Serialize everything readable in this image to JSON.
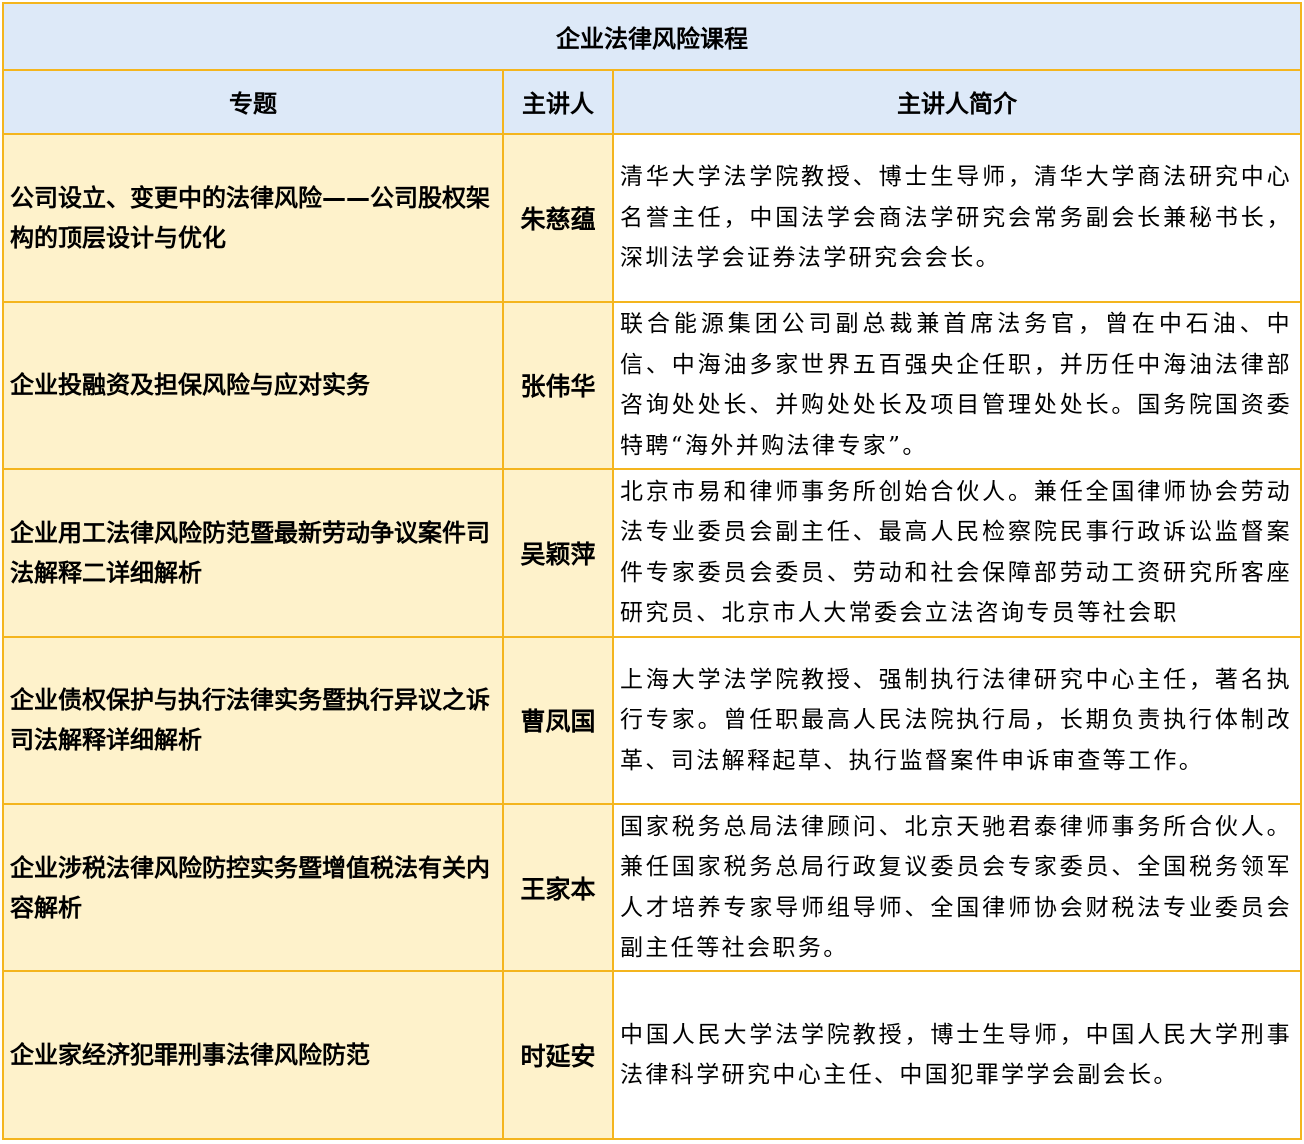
{
  "table": {
    "title": "企业法律风险课程",
    "headers": {
      "topic": "专题",
      "speaker": "主讲人",
      "bio": "主讲人简介"
    },
    "rows": [
      {
        "topic": "公司设立、变更中的法律风险——公司股权架构的顶层设计与优化",
        "speaker": "朱慈蕴",
        "bio": "清华大学法学院教授、博士生导师，清华大学商法研究中心名誉主任，中国法学会商法学研究会常务副会长兼秘书长，深圳法学会证券法学研究会会长。"
      },
      {
        "topic": "企业投融资及担保风险与应对实务",
        "speaker": "张伟华",
        "bio": "联合能源集团公司副总裁兼首席法务官，曾在中石油、中信、中海油多家世界五百强央企任职，并历任中海油法律部咨询处处长、并购处处长及项目管理处处长。国务院国资委特聘“海外并购法律专家”。"
      },
      {
        "topic": "企业用工法律风险防范暨最新劳动争议案件司法解释二详细解析",
        "speaker": "吴颖萍",
        "bio": "北京市易和律师事务所创始合伙人。兼任全国律师协会劳动法专业委员会副主任、最高人民检察院民事行政诉讼监督案件专家委员会委员、劳动和社会保障部劳动工资研究所客座研究员、北京市人大常委会立法咨询专员等社会职"
      },
      {
        "topic": "企业债权保护与执行法律实务暨执行异议之诉司法解释详细解析",
        "speaker": "曹凤国",
        "bio": "上海大学法学院教授、强制执行法律研究中心主任，著名执行专家。曾任职最高人民法院执行局，长期负责执行体制改革、司法解释起草、执行监督案件申诉审查等工作。"
      },
      {
        "topic": "企业涉税法律风险防控实务暨增值税法有关内容解析",
        "speaker": "王家本",
        "bio": "国家税务总局法律顾问、北京天驰君泰律师事务所合伙人。兼任国家税务总局行政复议委员会专家委员、全国税务领军人才培养专家导师组导师、全国律师协会财税法专业委员会副主任等社会职务。"
      },
      {
        "topic": "企业家经济犯罪刑事法律风险防范",
        "speaker": "时延安",
        "bio": "中国人民大学法学院教授，博士生导师，中国人民大学刑事法律科学研究中心主任、中国犯罪学学会副会长。"
      }
    ]
  },
  "colors": {
    "border": "#f4b51e",
    "header_bg": "#dde9f8",
    "row_bg": "#fef2cb",
    "bio_bg": "#ffffff"
  }
}
